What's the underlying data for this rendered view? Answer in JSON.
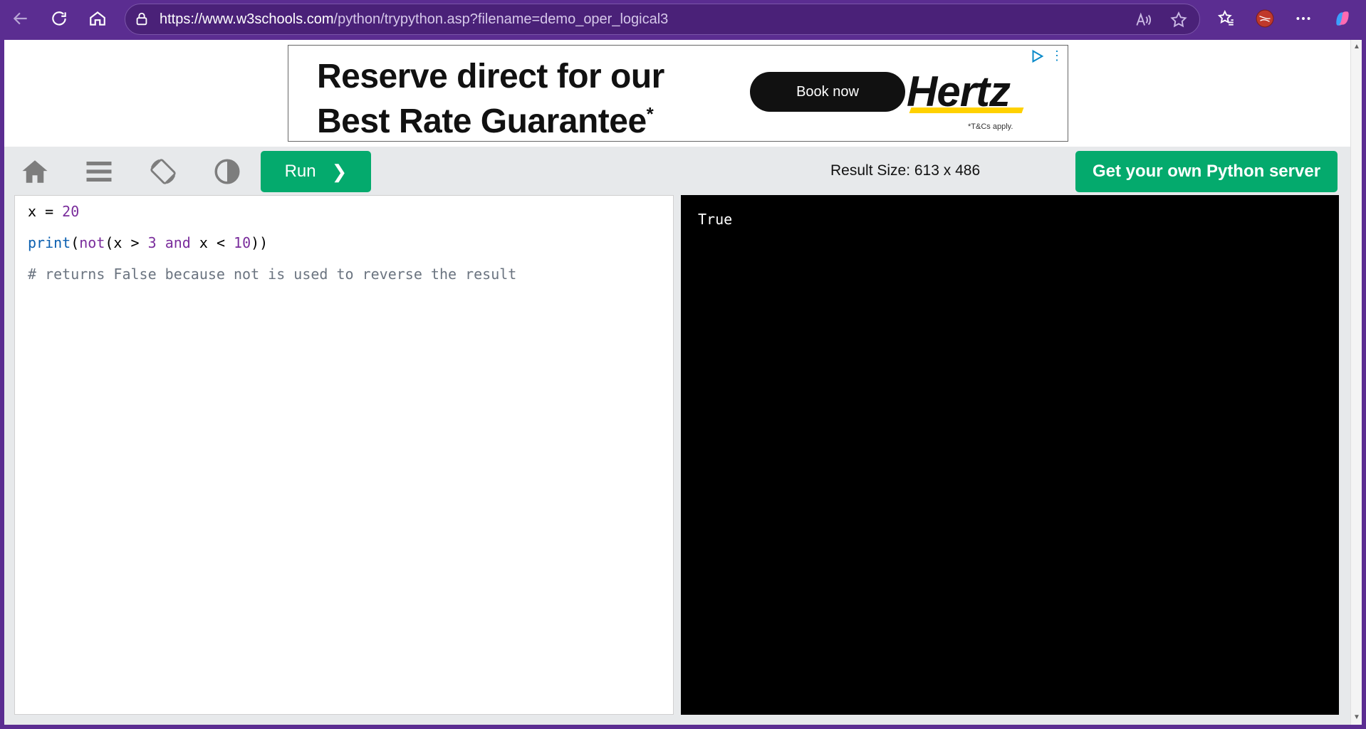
{
  "browser": {
    "url_host": "https://www.w3schools.com",
    "url_path": "/python/trypython.asp?filename=demo_oper_logical3",
    "icons": [
      "back-icon",
      "refresh-icon",
      "home-icon",
      "lock-icon",
      "read-aloud-icon",
      "favorite-star-icon",
      "favorites-icon",
      "profile-avatar",
      "more-icon",
      "copilot-icon"
    ]
  },
  "ad": {
    "headline_1": "Reserve direct for our",
    "headline_2": "Best Rate Guarantee",
    "asterisk": "*",
    "cta": "Book now",
    "brand": "Hertz",
    "terms": "*T&Cs apply."
  },
  "toolbar": {
    "run_label": "Run",
    "run_chevron": "❯",
    "result_size": "Result Size: 613 x 486",
    "server_label": "Get your own Python server",
    "icons": [
      "home-icon",
      "menu-icon",
      "rotate-icon",
      "contrast-icon"
    ]
  },
  "editor": {
    "lines": {
      "l1_a": "x = ",
      "l1_b": "20",
      "l2_fn": "print",
      "l2_p1": "(",
      "l2_not": "not",
      "l2_p2": "(x > ",
      "l2_n1": "3",
      "l2_sp": " ",
      "l2_and": "and",
      "l2_p3": " x < ",
      "l2_n2": "10",
      "l2_p4": "))",
      "l3": "# returns False because not is used to reverse the result"
    }
  },
  "output": {
    "text": "True"
  },
  "colors": {
    "chrome": "#5b2d91",
    "accent_green": "#04aa6d",
    "toolbar_bg": "#e7e9eb"
  }
}
